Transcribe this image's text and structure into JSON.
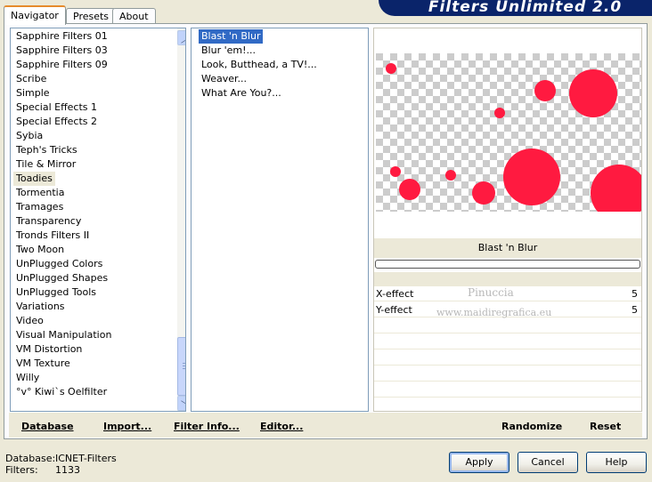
{
  "tabs": [
    {
      "label": "Navigator",
      "active": true
    },
    {
      "label": "Presets",
      "active": false
    },
    {
      "label": "About",
      "active": false
    }
  ],
  "brand": "Filters Unlimited 2.0",
  "categories": [
    "Sapphire Filters 01",
    "Sapphire Filters 03",
    "Sapphire Filters 09",
    "Scribe",
    "Simple",
    "Special Effects 1",
    "Special Effects 2",
    "Sybia",
    "Teph's Tricks",
    "Tile & Mirror",
    "Toadies",
    "Tormentia",
    "Tramages",
    "Transparency",
    "Tronds Filters II",
    "Two Moon",
    "UnPlugged Colors",
    "UnPlugged Shapes",
    "UnPlugged Tools",
    "Variations",
    "Video",
    "Visual Manipulation",
    "VM Distortion",
    "VM Texture",
    "Willy",
    "°v° Kiwi`s Oelfilter"
  ],
  "selected_category": "Toadies",
  "filters": [
    "Blast 'n Blur",
    "Blur 'em!...",
    "Look, Butthead, a TV!...",
    "Weaver...",
    "What Are You?..."
  ],
  "selected_filter": "Blast 'n Blur",
  "filter_title": "Blast 'n Blur",
  "params": [
    {
      "label": "X-effect",
      "value": "5"
    },
    {
      "label": "Y-effect",
      "value": "5"
    }
  ],
  "watermark": {
    "line1": "Pinuccia",
    "line2": "www.maidiregrafica.eu"
  },
  "toolbar": {
    "database": "Database",
    "import": "Import...",
    "filter_info": "Filter Info...",
    "editor": "Editor...",
    "randomize": "Randomize",
    "reset": "Reset"
  },
  "status": {
    "database_label": "Database:",
    "database_value": "ICNET-Filters",
    "filters_label": "Filters:",
    "filters_value": "1133"
  },
  "buttons": {
    "apply": "Apply",
    "cancel": "Cancel",
    "help": "Help"
  },
  "colors": {
    "accent": "#316ac5",
    "dot": "#ff1a40",
    "brand_bg": "#0a246a"
  }
}
